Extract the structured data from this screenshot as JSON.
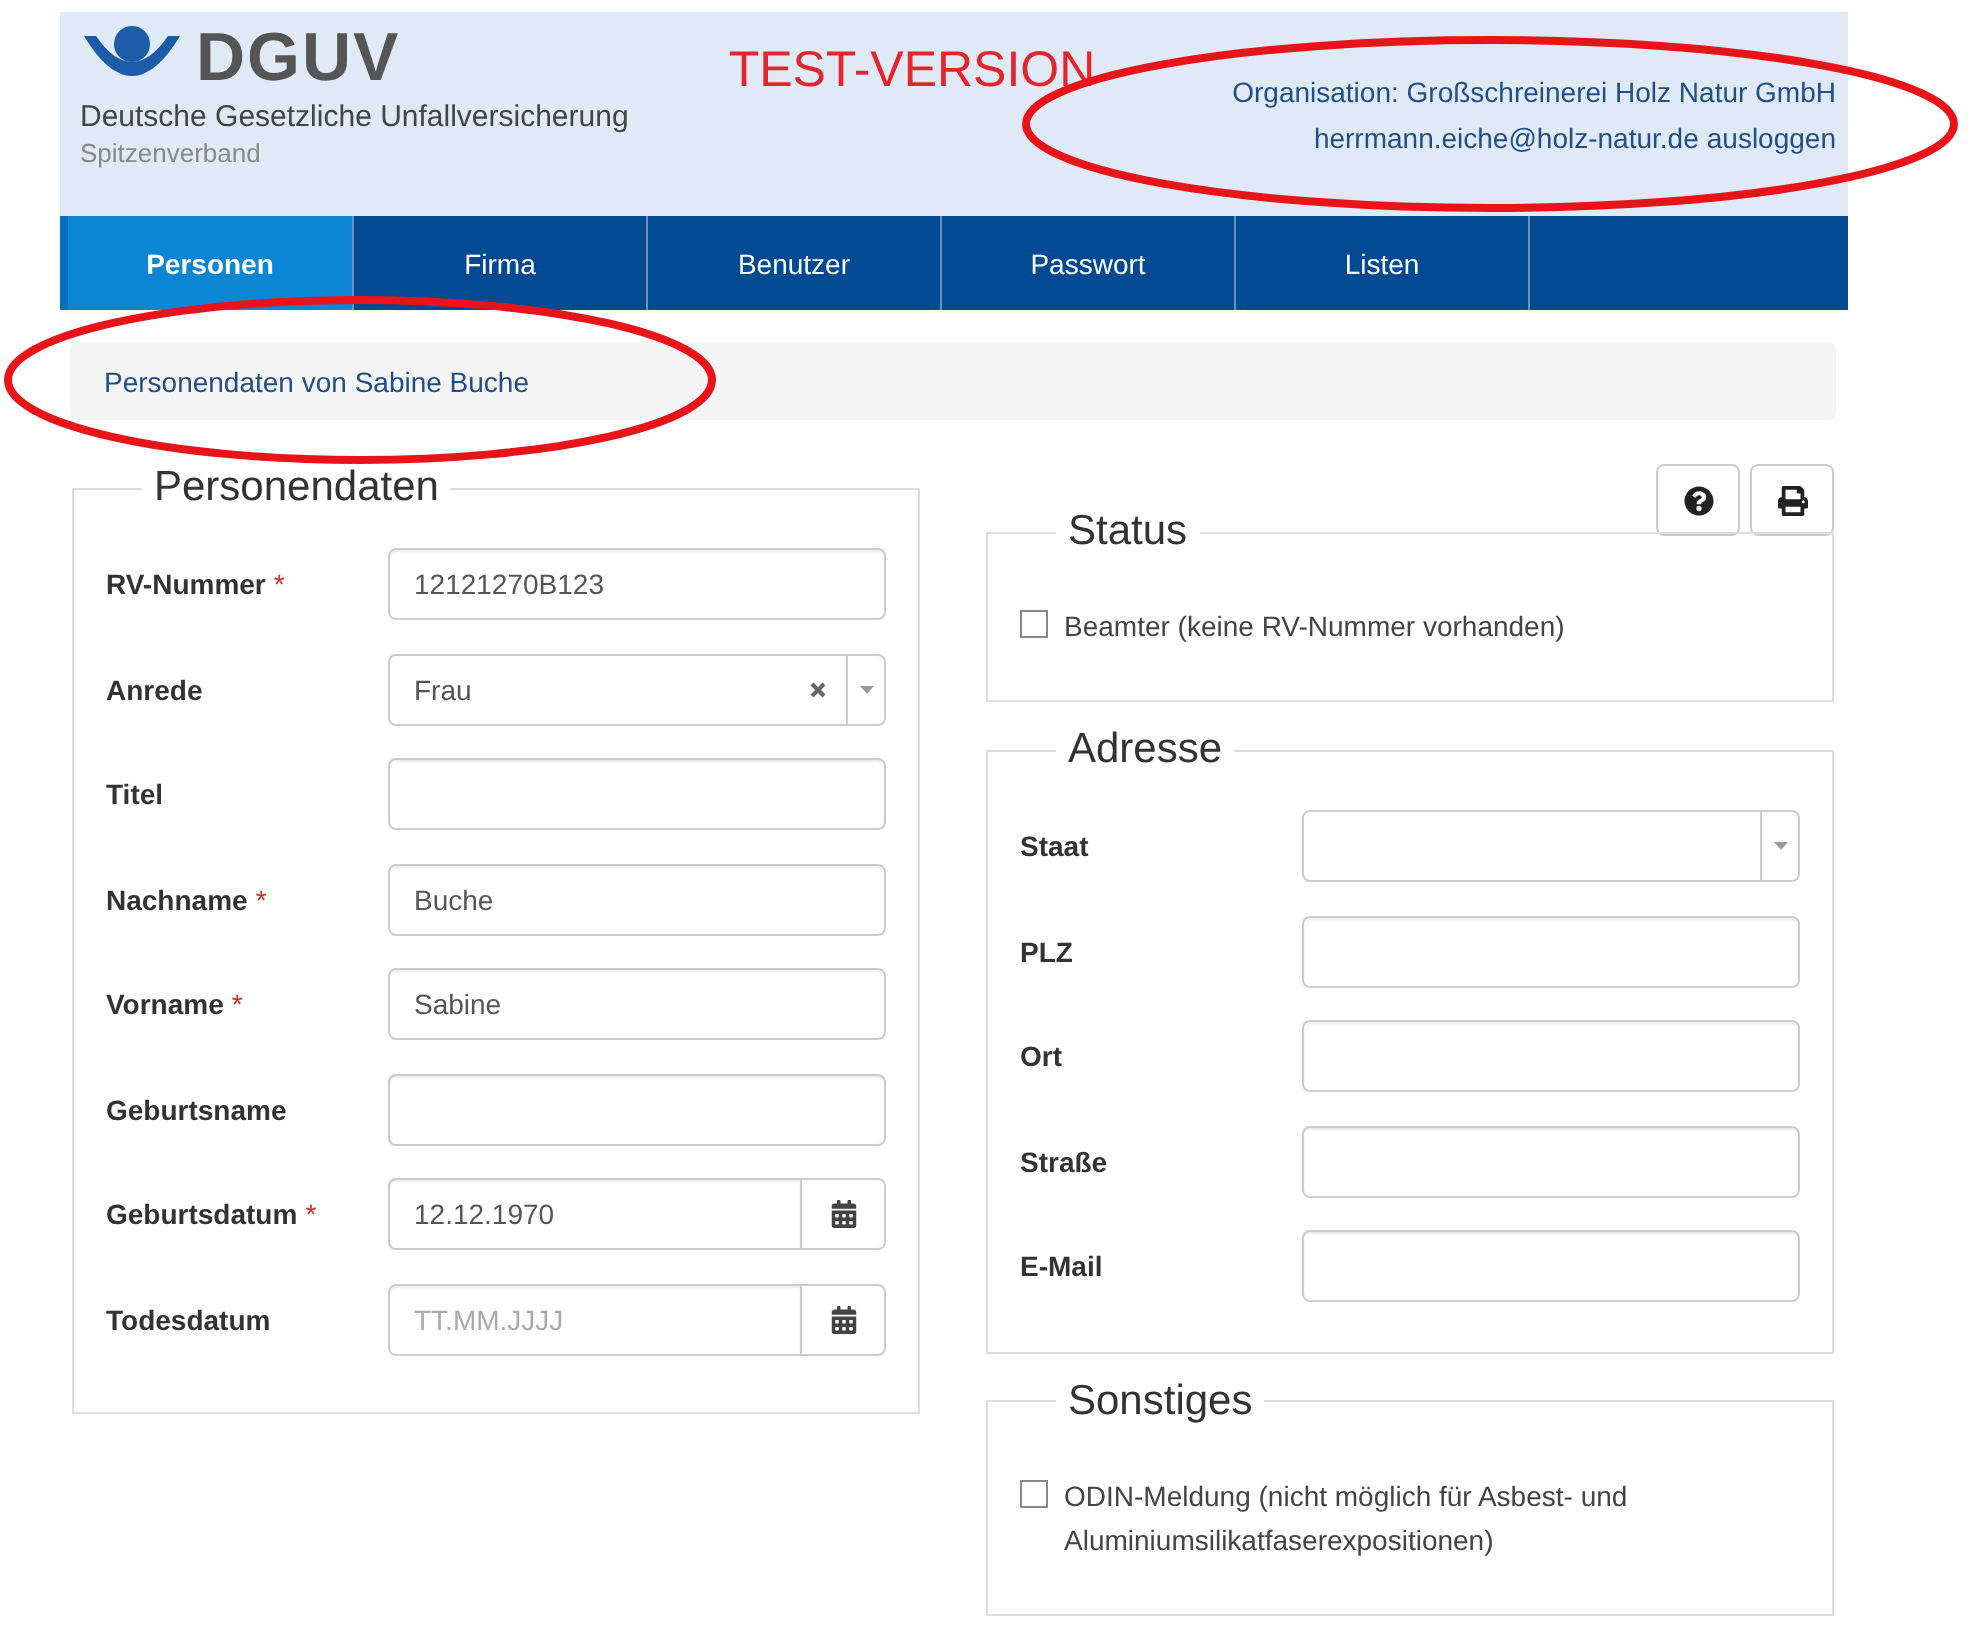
{
  "header": {
    "logo": "DGUV",
    "logo_subtitle": "Deutsche Gesetzliche Unfallversicherung",
    "logo_tagline": "Spitzenverband",
    "test_label": "TEST-VERSION",
    "organisation": "Organisation: Großschreinerei Holz Natur GmbH",
    "user_email": "herrmann.eiche@holz-natur.de",
    "logout": "ausloggen"
  },
  "tabs": [
    {
      "label": "Personen",
      "selected": true
    },
    {
      "label": "Firma",
      "selected": false
    },
    {
      "label": "Benutzer",
      "selected": false
    },
    {
      "label": "Passwort",
      "selected": false
    },
    {
      "label": "Listen",
      "selected": false
    }
  ],
  "breadcrumb": "Personendaten von Sabine Buche",
  "personendaten": {
    "legend": "Personendaten",
    "fields": [
      {
        "label": "RV-Nummer",
        "required_mark": "*",
        "kind": "text",
        "value": "12121270B123"
      },
      {
        "label": "Anrede",
        "kind": "select",
        "value": "Frau",
        "clearable": true
      },
      {
        "label": "Titel",
        "kind": "text"
      },
      {
        "label": "Nachname",
        "required_mark": "*",
        "kind": "text",
        "value": "Buche"
      },
      {
        "label": "Vorname",
        "required_mark": "*",
        "kind": "text",
        "value": "Sabine"
      },
      {
        "label": "Geburtsname",
        "kind": "text"
      },
      {
        "label": "Geburtsdatum",
        "required_mark": "*",
        "kind": "date",
        "value": "12.12.1970"
      },
      {
        "label": "Todesdatum",
        "kind": "date",
        "placeholder": "TT.MM.JJJJ"
      }
    ]
  },
  "status": {
    "legend": "Status",
    "checkbox": {
      "label": "Beamter (keine RV-Nummer vorhanden)",
      "checked": false
    }
  },
  "adresse": {
    "legend": "Adresse",
    "fields": [
      {
        "label": "Staat",
        "kind": "select"
      },
      {
        "label": "PLZ",
        "kind": "text"
      },
      {
        "label": "Ort",
        "kind": "text"
      },
      {
        "label": "Straße",
        "kind": "text"
      },
      {
        "label": "E-Mail",
        "kind": "text"
      }
    ]
  },
  "sonstiges": {
    "legend": "Sonstiges",
    "checkbox": {
      "label": "ODIN-Meldung (nicht möglich für Asbest- und Aluminiumsilikatfaserexpositionen)",
      "checked": false
    }
  },
  "annotations": [
    {
      "kind": "ellipse"
    },
    {
      "kind": "ellipse"
    }
  ]
}
